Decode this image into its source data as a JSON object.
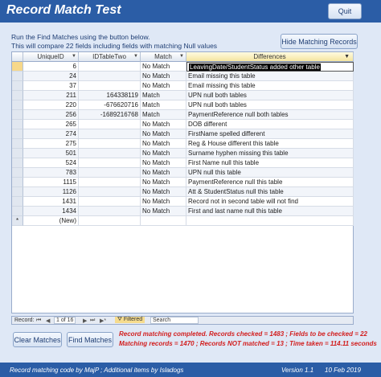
{
  "title": "Record Match Test",
  "quit_label": "Quit",
  "intro": {
    "line1": "Run the Find Matches using the button below.",
    "line2": "This will compare 22 fields including fields with matching Null values"
  },
  "hide_button": "Hide Matching Records",
  "grid": {
    "columns": [
      "UniqueID",
      "IDTableTwo",
      "Match",
      "Differences"
    ],
    "rows": [
      {
        "uid": "6",
        "idt": "",
        "match": "No Match",
        "diff": "LeavingDate/StudentStatus added other table"
      },
      {
        "uid": "24",
        "idt": "",
        "match": "No Match",
        "diff": "Email missing this table"
      },
      {
        "uid": "37",
        "idt": "",
        "match": "No Match",
        "diff": "Email missing this table"
      },
      {
        "uid": "211",
        "idt": "164338119",
        "match": "Match",
        "diff": "UPN null both tables"
      },
      {
        "uid": "220",
        "idt": "-676620716",
        "match": "Match",
        "diff": "UPN null both tables"
      },
      {
        "uid": "256",
        "idt": "-1689216768",
        "match": "Match",
        "diff": "PaymentReference null both tables"
      },
      {
        "uid": "265",
        "idt": "",
        "match": "No Match",
        "diff": "DOB different"
      },
      {
        "uid": "274",
        "idt": "",
        "match": "No Match",
        "diff": "FirstName spelled different"
      },
      {
        "uid": "275",
        "idt": "",
        "match": "No Match",
        "diff": "Reg & House different this table"
      },
      {
        "uid": "501",
        "idt": "",
        "match": "No Match",
        "diff": "Surname hyphen missing this table"
      },
      {
        "uid": "524",
        "idt": "",
        "match": "No Match",
        "diff": "First Name null this table"
      },
      {
        "uid": "783",
        "idt": "",
        "match": "No Match",
        "diff": "UPN null this table"
      },
      {
        "uid": "1115",
        "idt": "",
        "match": "No Match",
        "diff": "PaymentReference null this table"
      },
      {
        "uid": "1126",
        "idt": "",
        "match": "No Match",
        "diff": "Att & StudentStatus null this table"
      },
      {
        "uid": "1431",
        "idt": "",
        "match": "No Match",
        "diff": "Record not in second table will not find"
      },
      {
        "uid": "1434",
        "idt": "",
        "match": "No Match",
        "diff": "First and last name null this table"
      }
    ],
    "new_row_marker": "*",
    "new_row_label": "(New)"
  },
  "navbar": {
    "record_label": "Record:",
    "first": "⏮",
    "prev": "◀",
    "position": "1 of 16",
    "next": "▶",
    "last": "⏭",
    "new": "▶*",
    "filtered": "Filtered",
    "search": "Search"
  },
  "clear_button": "Clear Matches",
  "find_button": "Find Matches",
  "status": {
    "line1": "Record matching completed. Records checked = 1483 ; Fields to be checked = 22",
    "line2": "Matching records = 1470 ; Records NOT matched = 13 ; Time taken = 114.11 seconds"
  },
  "footer": {
    "credit": "Record matching code by MajP ;  Additional items by Isladogs",
    "version": "Version 1.1",
    "date": "10 Feb 2019"
  },
  "colors": {
    "title_bar": "#2b5da6",
    "status_text": "#d21e1e",
    "background": "#dfe8f6"
  }
}
